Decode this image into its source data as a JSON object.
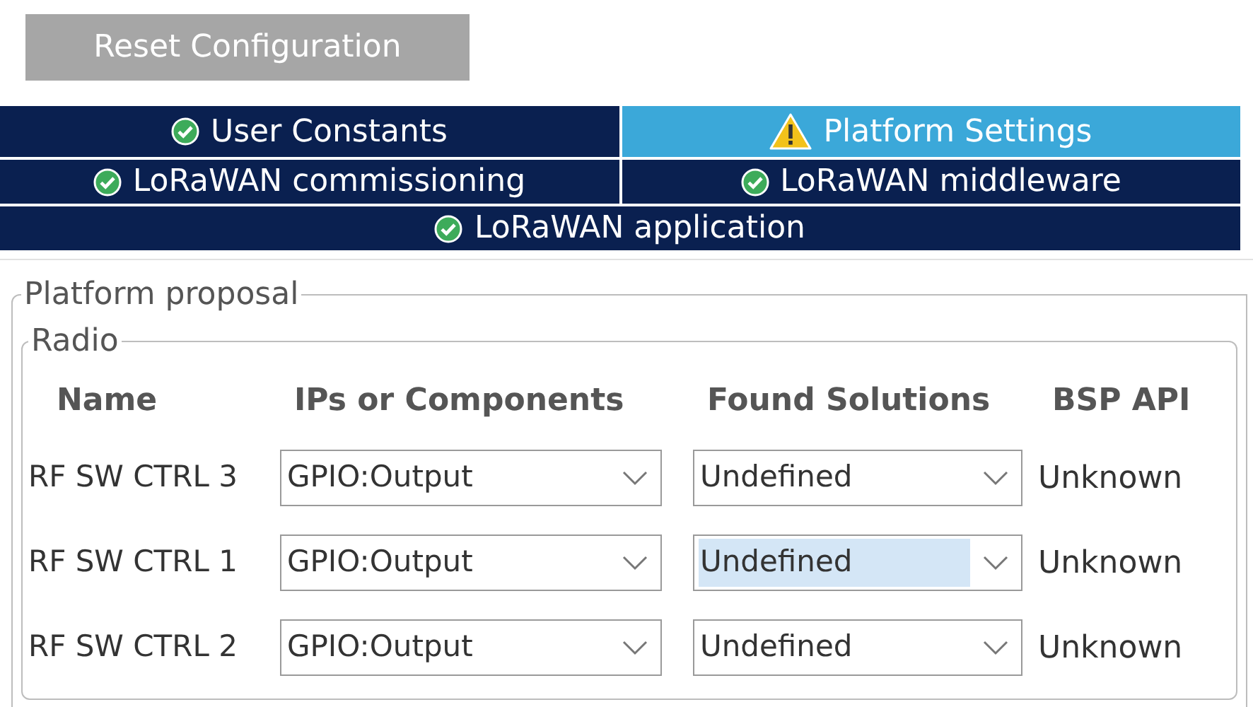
{
  "reset_button": "Reset Configuration",
  "tab_rows": [
    [
      {
        "label": "User Constants",
        "kind": "ok",
        "selected": false
      },
      {
        "label": "Platform Settings",
        "kind": "warning",
        "selected": true
      }
    ],
    [
      {
        "label": "LoRaWAN commissioning",
        "kind": "ok",
        "selected": false
      },
      {
        "label": "LoRaWAN middleware",
        "kind": "ok",
        "selected": false
      }
    ],
    [
      {
        "label": "LoRaWAN application",
        "kind": "ok",
        "selected": false
      }
    ]
  ],
  "platform_proposal": {
    "title": "Platform proposal",
    "radio": {
      "title": "Radio",
      "columns": [
        "Name",
        "IPs or Components",
        "Found Solutions",
        "BSP API"
      ],
      "rows": [
        {
          "name": "RF SW CTRL 3",
          "ip": "GPIO:Output",
          "solution": "Undefined",
          "solution_selected": false,
          "bsp_api": "Unknown"
        },
        {
          "name": "RF SW CTRL 1",
          "ip": "GPIO:Output",
          "solution": "Undefined",
          "solution_selected": true,
          "bsp_api": "Unknown"
        },
        {
          "name": "RF SW CTRL 2",
          "ip": "GPIO:Output",
          "solution": "Undefined",
          "solution_selected": false,
          "bsp_api": "Unknown"
        }
      ]
    }
  }
}
